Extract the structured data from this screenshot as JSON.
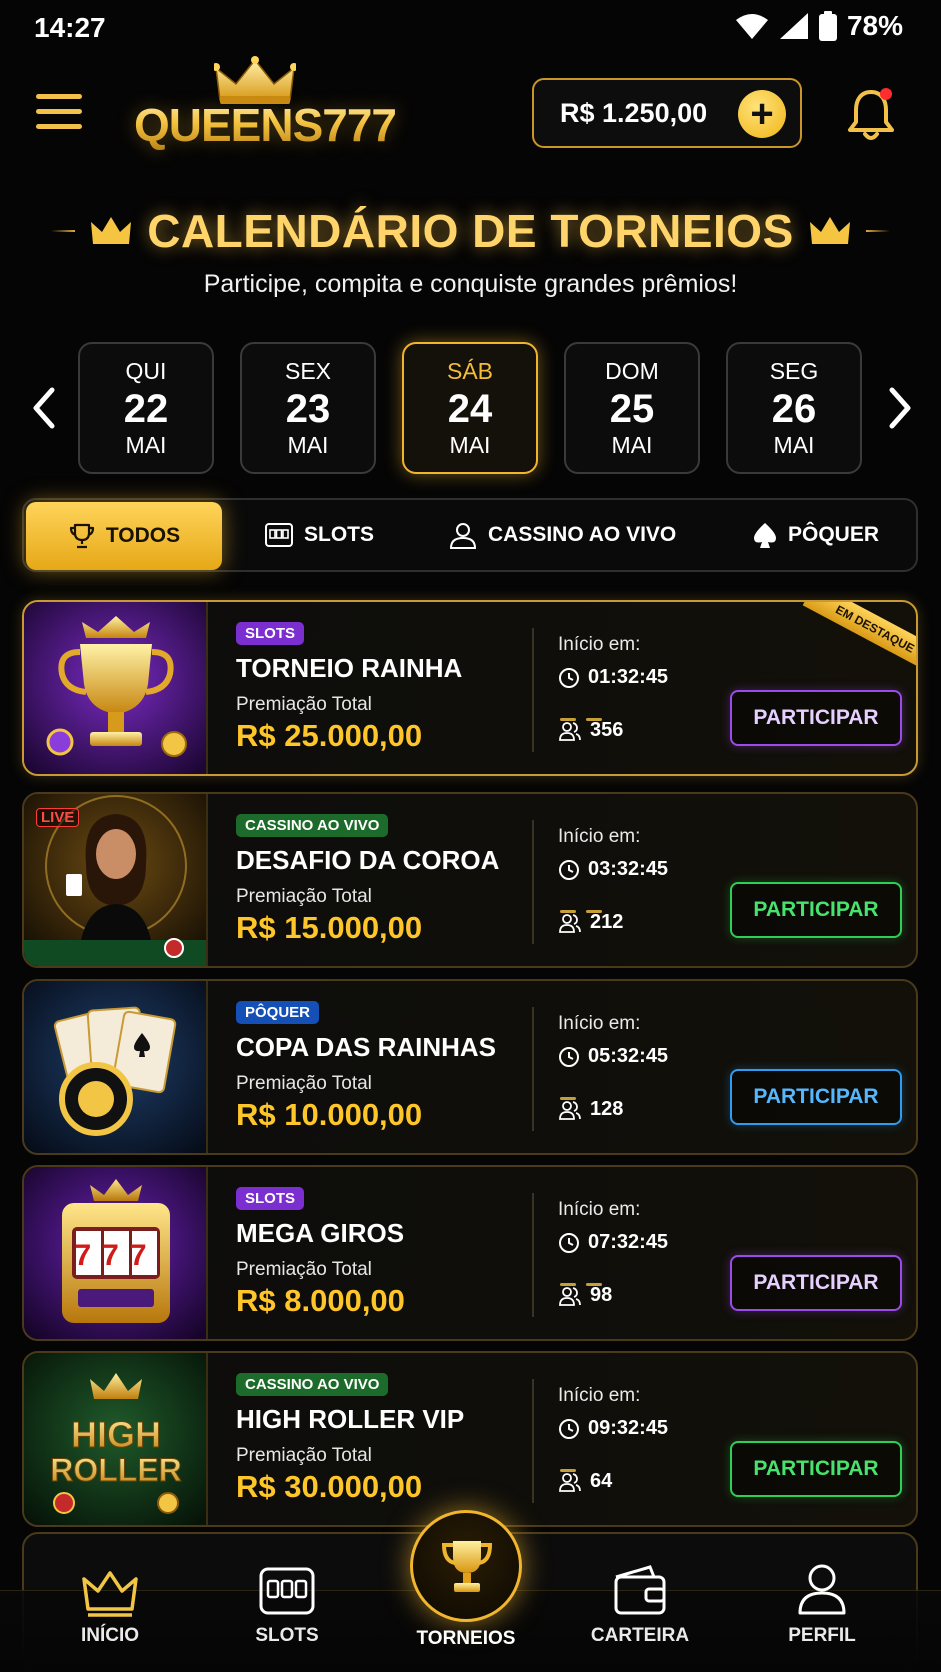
{
  "status_bar": {
    "time": "14:27",
    "battery": "78%"
  },
  "header": {
    "brand": "QUEENS777",
    "balance": "R$ 1.250,00",
    "add_label": "+"
  },
  "hero": {
    "title": "CALENDÁRIO DE TORNEIOS",
    "subtitle": "Participe, compita e conquiste grandes prêmios!"
  },
  "dates": [
    {
      "dow": "QUI",
      "day": "22",
      "month": "MAI"
    },
    {
      "dow": "SEX",
      "day": "23",
      "month": "MAI"
    },
    {
      "dow": "SÁB",
      "day": "24",
      "month": "MAI",
      "active": true
    },
    {
      "dow": "DOM",
      "day": "25",
      "month": "MAI"
    },
    {
      "dow": "SEG",
      "day": "26",
      "month": "MAI"
    }
  ],
  "filters": [
    {
      "label": "TODOS",
      "icon": "trophy-icon",
      "active": true
    },
    {
      "label": "SLOTS",
      "icon": "slot-machine-icon"
    },
    {
      "label": "CASSINO AO VIVO",
      "icon": "dealer-icon"
    },
    {
      "label": "PÔQUER",
      "icon": "spade-icon"
    }
  ],
  "featured_ribbon": "EM DESTAQUE",
  "live_tag": "LIVE",
  "tournaments": [
    {
      "category": "SLOTS",
      "name": "TORNEIO RAINHA",
      "prize_label": "Premiação Total",
      "prize": "R$ 25.000,00",
      "start_label": "Início em:",
      "timer": "01:32:45",
      "players": "356",
      "cta": "PARTICIPAR",
      "accent": "#9b4be8"
    },
    {
      "category": "CASSINO AO VIVO",
      "name": "DESAFIO DA COROA",
      "prize_label": "Premiação Total",
      "prize": "R$ 15.000,00",
      "start_label": "Início em:",
      "timer": "03:32:45",
      "players": "212",
      "cta": "PARTICIPAR",
      "accent": "#2fcf56"
    },
    {
      "category": "PÔQUER",
      "name": "COPA DAS RAINHAS",
      "prize_label": "Premiação Total",
      "prize": "R$ 10.000,00",
      "start_label": "Início em:",
      "timer": "05:32:45",
      "players": "128",
      "cta": "PARTICIPAR",
      "accent": "#2e9cf0"
    },
    {
      "category": "SLOTS",
      "name": "MEGA GIROS",
      "prize_label": "Premiação Total",
      "prize": "R$ 8.000,00",
      "start_label": "Início em:",
      "timer": "07:32:45",
      "players": "98",
      "cta": "PARTICIPAR",
      "accent": "#9b4be8"
    },
    {
      "category": "CASSINO AO VIVO",
      "name": "HIGH ROLLER VIP",
      "prize_label": "Premiação Total",
      "prize": "R$ 30.000,00",
      "start_label": "Início em:",
      "timer": "09:32:45",
      "players": "64",
      "cta": "PARTICIPAR",
      "accent": "#2fcf56"
    }
  ],
  "thumbnails": {
    "high_roller_text_1": "HIGH",
    "high_roller_text_2": "ROLLER",
    "slot_reels": "777"
  },
  "bottom_nav": [
    {
      "label": "INÍCIO",
      "icon": "crown-icon"
    },
    {
      "label": "SLOTS",
      "icon": "slot-machine-icon"
    },
    {
      "label": "TORNEIOS",
      "icon": "trophy-icon",
      "active": true
    },
    {
      "label": "CARTEIRA",
      "icon": "wallet-icon"
    },
    {
      "label": "PERFIL",
      "icon": "user-icon"
    }
  ],
  "colors": {
    "gold": "#f2b62e",
    "prize": "#ffc629",
    "background": "#050505",
    "notification_dot": "#ff2d2d"
  }
}
